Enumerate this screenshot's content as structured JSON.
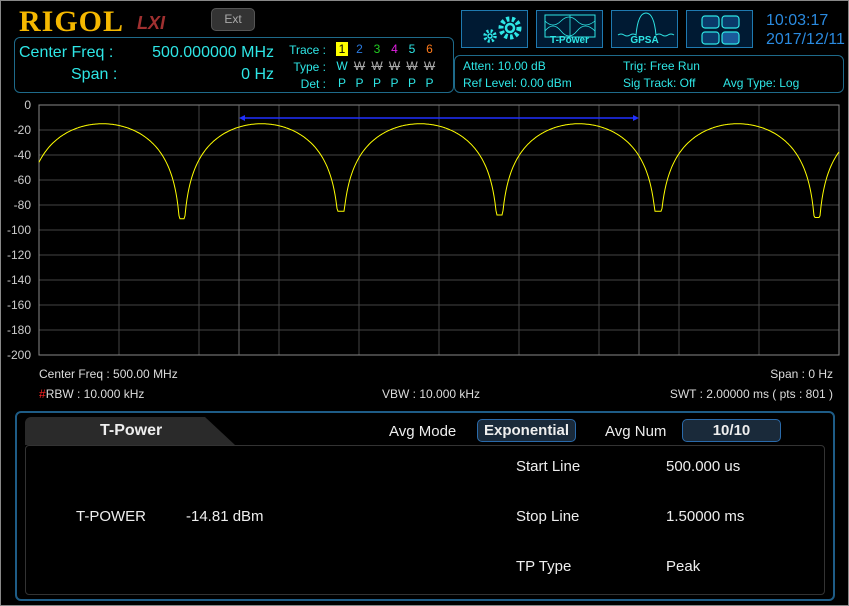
{
  "header": {
    "logo": "RIGOL",
    "logo_sub": "LXI",
    "ext_button": "Ext",
    "time": "10:03:17",
    "date": "2017/12/11",
    "center_freq_label": "Center Freq :",
    "center_freq_value": "500.000000 MHz",
    "span_label": "Span :",
    "span_value": "0 Hz",
    "trace_label": "Trace :",
    "type_label": "Type :",
    "det_label": "Det :",
    "traces": [
      {
        "n": "1",
        "type": "W",
        "det": "P",
        "color": "#ffff00"
      },
      {
        "n": "2",
        "type": "W",
        "det": "P",
        "color": "#2a7adf"
      },
      {
        "n": "3",
        "type": "W",
        "det": "P",
        "color": "#22cc22"
      },
      {
        "n": "4",
        "type": "W",
        "det": "P",
        "color": "#e020e0"
      },
      {
        "n": "5",
        "type": "W",
        "det": "P",
        "color": "#2ee6e6"
      },
      {
        "n": "6",
        "type": "W",
        "det": "P",
        "color": "#ff7a1a"
      }
    ],
    "atten": "Atten: 10.00 dB",
    "ref_level": "Ref Level: 0.00 dBm",
    "trig": "Trig: Free Run",
    "sig_track": "Sig Track: Off",
    "avg_type": "Avg Type: Log",
    "mode_buttons": [
      {
        "icon": "gear-icon",
        "label": ""
      },
      {
        "icon": "t-power-icon",
        "label": "T-Power"
      },
      {
        "icon": "gpsa-icon",
        "label": "GPSA"
      },
      {
        "icon": "window-layout-icon",
        "label": ""
      }
    ]
  },
  "chart_data": {
    "type": "line",
    "ylim": [
      -200,
      0
    ],
    "yticks": [
      "0",
      "-20",
      "-40",
      "-60",
      "-80",
      "-100",
      "-120",
      "-140",
      "-160",
      "-180",
      "-200"
    ],
    "xlim_ms": [
      0,
      2
    ],
    "grid": true,
    "series": [
      {
        "color": "#ffff00",
        "peak_dbm": -15,
        "notch_dbm": [
          -91,
          -85,
          -88,
          -85,
          -90
        ],
        "notch_times_ms": [
          0.3575,
          0.7525,
          1.15,
          1.5475,
          1.945
        ]
      }
    ],
    "lines_ms": [
      0.5,
      1.5
    ],
    "accent": "#2030ff"
  },
  "status": {
    "center_freq": "Center Freq : 500.00 MHz",
    "span": "Span : 0 Hz",
    "rbw_mark": "#",
    "rbw": "RBW : 10.000 kHz",
    "vbw": "VBW : 10.000 kHz",
    "swt": "SWT : 2.00000 ms ( pts : 801 )"
  },
  "measure": {
    "tab": "T-Power",
    "avg_mode_label": "Avg Mode",
    "avg_mode_value": "Exponential",
    "avg_num_label": "Avg Num",
    "avg_num_value": "10/10",
    "result_label": "T-POWER",
    "result_value": "-14.81 dBm",
    "params": [
      {
        "label": "Start Line",
        "value": "500.000 us"
      },
      {
        "label": "Stop Line",
        "value": "1.50000 ms"
      },
      {
        "label": "TP Type",
        "value": "Peak"
      }
    ]
  }
}
